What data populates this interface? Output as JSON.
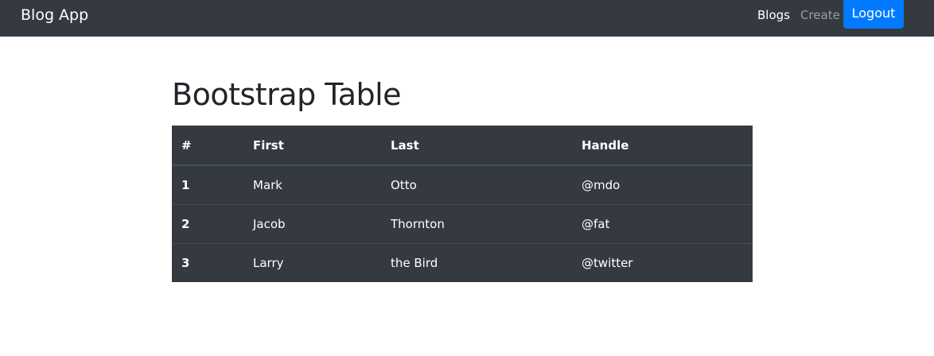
{
  "navbar": {
    "brand": "Blog App",
    "links": [
      "Blogs",
      "Create"
    ],
    "logout": "Logout",
    "accent": "#007bff",
    "background": "#343a40"
  },
  "page": {
    "title": "Bootstrap Table"
  },
  "table": {
    "headers": [
      "#",
      "First",
      "Last",
      "Handle"
    ],
    "rows": [
      [
        "1",
        "Mark",
        "Otto",
        "@mdo"
      ],
      [
        "2",
        "Jacob",
        "Thornton",
        "@fat"
      ],
      [
        "3",
        "Larry",
        "the Bird",
        "@twitter"
      ]
    ]
  }
}
